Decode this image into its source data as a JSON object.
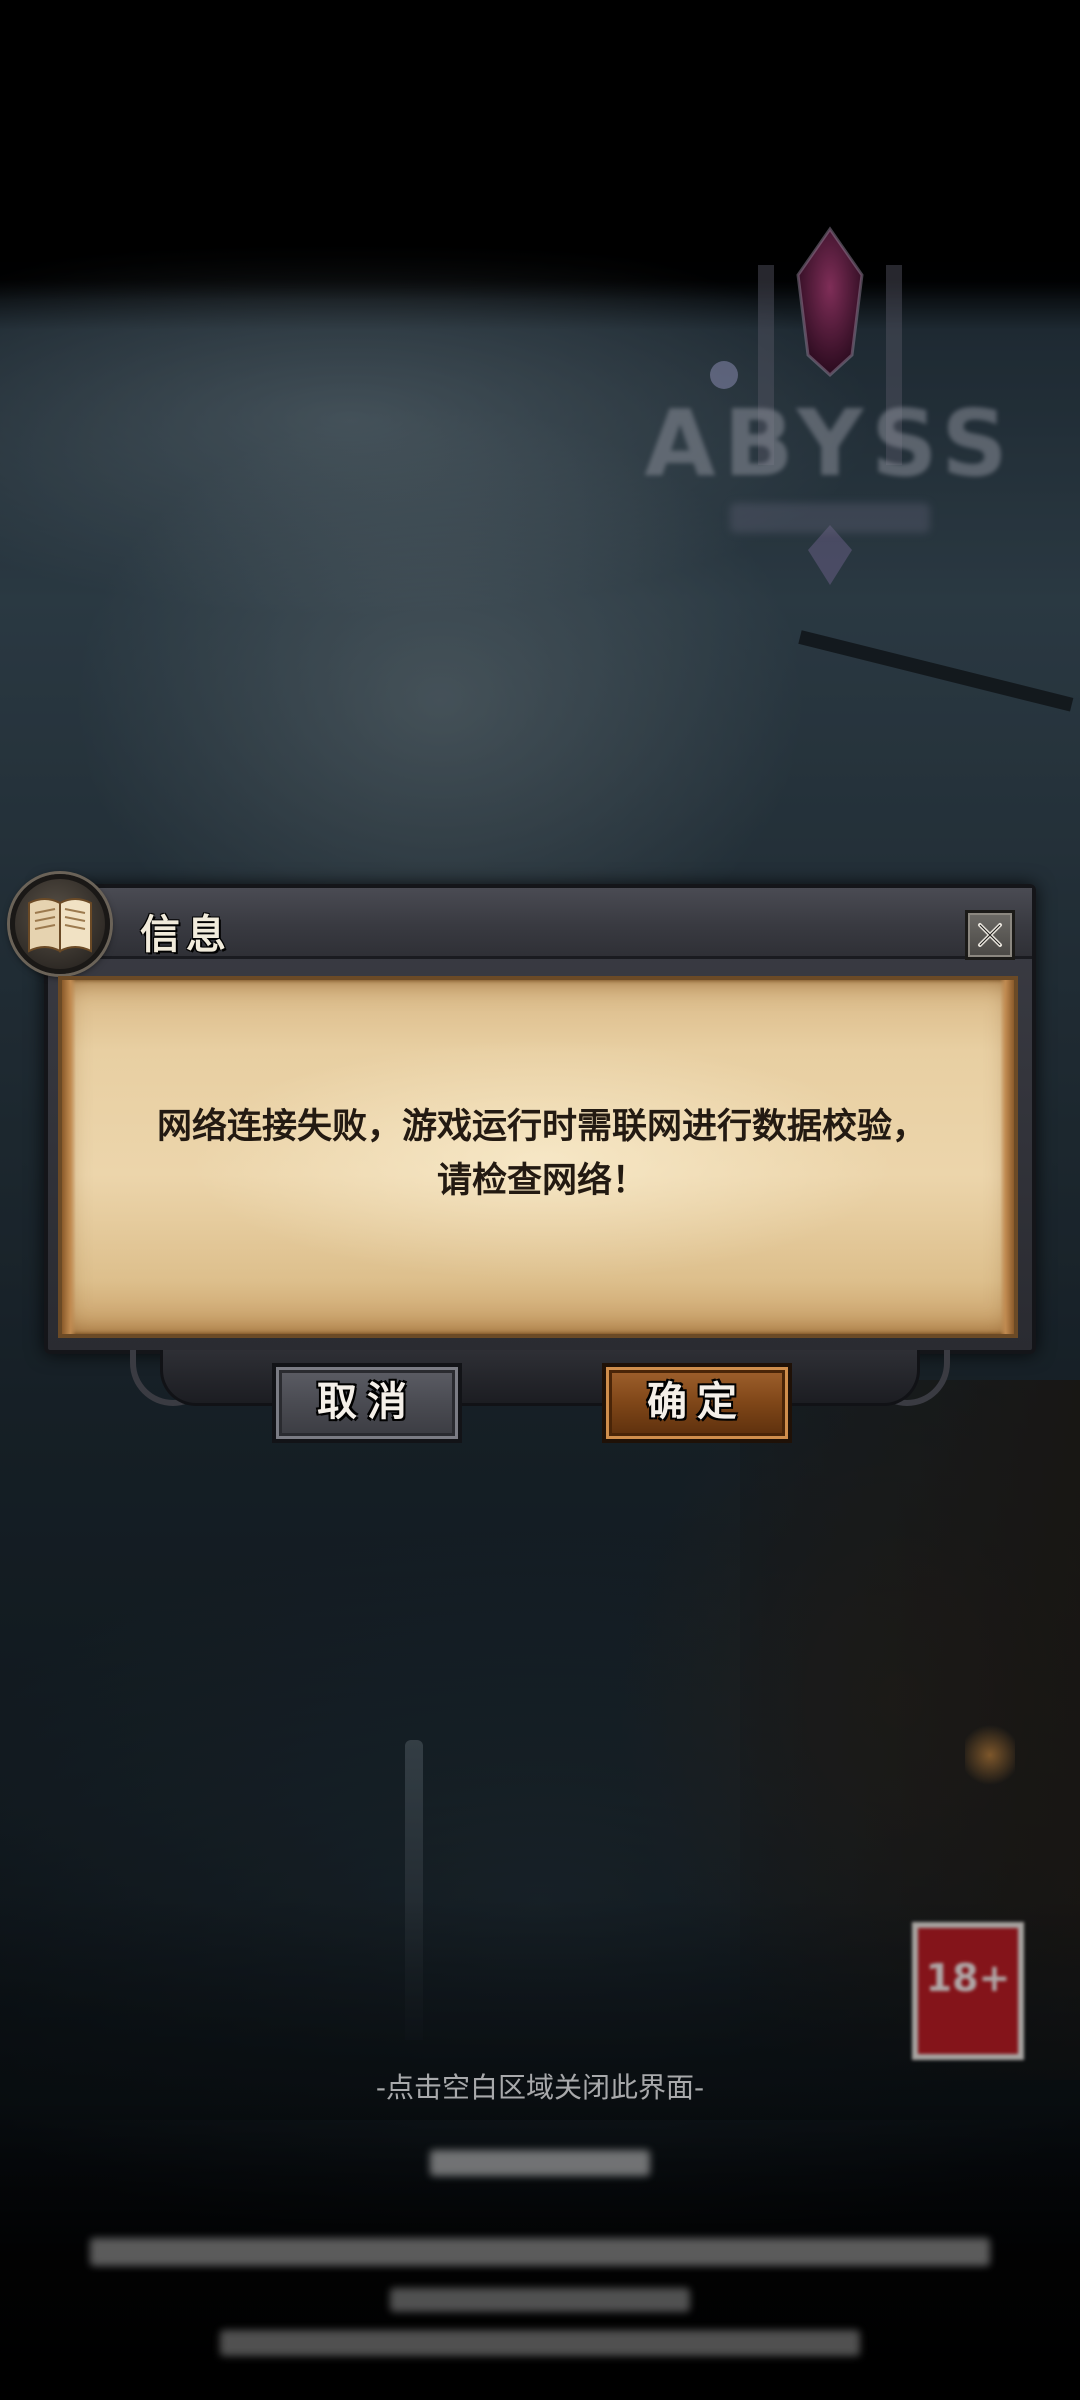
{
  "logo": {
    "text": "ABYSS"
  },
  "age_rating": {
    "label": "18+"
  },
  "dialog": {
    "title": "信息",
    "message_lines": [
      "网络连接失败，游戏运行时需联网进行数据校验，",
      "请检查网络！"
    ],
    "close_icon": "close-icon",
    "emblem_icon": "book-icon"
  },
  "buttons": {
    "cancel_label": "取消",
    "ok_label": "确定"
  },
  "hints": {
    "close_hint": "-点击空白区域关闭此界面-"
  },
  "colors": {
    "parchment": "#e8cfa2",
    "cancel_button": "#4a4b52",
    "ok_button": "#7f4618",
    "frame": "#3b3c44"
  }
}
